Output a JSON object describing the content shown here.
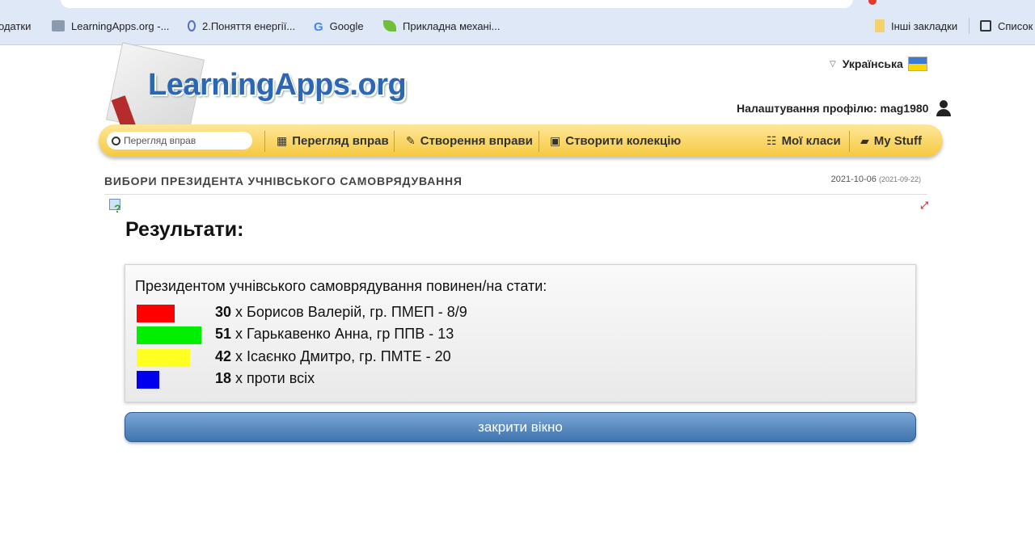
{
  "browser": {
    "bookmarks": [
      {
        "label": "одатки",
        "icon": "apps-icon"
      },
      {
        "label": "LearningApps.org -...",
        "icon": "learningapps-icon"
      },
      {
        "label": "2.Поняття енергії...",
        "icon": "site-icon"
      },
      {
        "label": "Google",
        "icon": "google-icon"
      },
      {
        "label": "Прикладна механі...",
        "icon": "leaf-icon"
      },
      {
        "label": "Інші закладки",
        "icon": "folder-icon"
      },
      {
        "label": "Список",
        "icon": "reading-list-icon"
      }
    ]
  },
  "header": {
    "logo": "LearningApps.org",
    "language": "Українська",
    "profile_label": "Налаштування профілю: mag1980"
  },
  "nav": {
    "search_placeholder": "Перегляд вправ",
    "items": [
      {
        "label": "Перегляд вправ",
        "icon": "grid-icon"
      },
      {
        "label": "Створення вправи",
        "icon": "pencil-icon"
      },
      {
        "label": "Створити колекцію",
        "icon": "collection-icon"
      },
      {
        "label": "Мої класи",
        "icon": "list-icon"
      },
      {
        "label": "My Stuff",
        "icon": "folder-icon"
      }
    ]
  },
  "activity": {
    "title": "ВИБОРИ ПРЕЗИДЕНТА УЧНІВСЬКОГО САМОВРЯДУВАННЯ",
    "date": "2021-10-06",
    "date_created": "(2021-09-22)"
  },
  "results": {
    "heading": "Результати:",
    "question": "Президентом учнівського самоврядування повинен/на стати:",
    "options": [
      {
        "count": "30",
        "text": "х Борисов Валерій, гр. ПМЕП - 8/9",
        "color": "#ff0000",
        "votes": 30
      },
      {
        "count": "51",
        "text": "х Гарькавенко Анна, гр ППВ - 13",
        "color": "#00ee00",
        "votes": 51
      },
      {
        "count": "42",
        "text": "х Ісаєнко Дмитро, гр. ПМТЕ - 20",
        "color": "#ffff22",
        "votes": 42
      },
      {
        "count": "18",
        "text": "х проти всіх",
        "color": "#0000ee",
        "votes": 18
      }
    ],
    "close_label": "закрити вікно"
  }
}
